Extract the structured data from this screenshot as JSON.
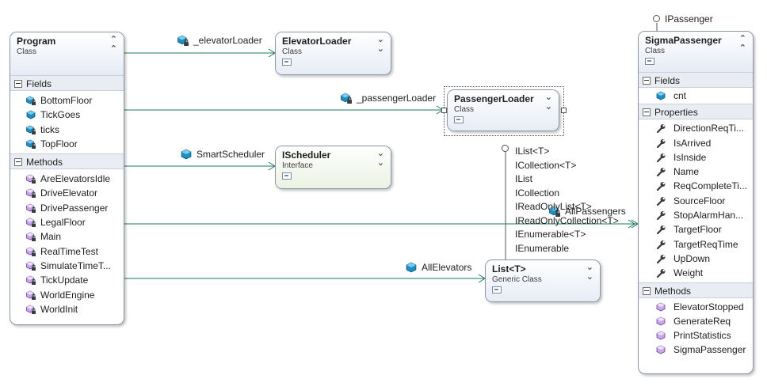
{
  "program": {
    "title": "Program",
    "kind": "Class",
    "fields_label": "Fields",
    "fields": [
      "BottomFloor",
      "TickGoes",
      "ticks",
      "TopFloor"
    ],
    "methods_label": "Methods",
    "methods": [
      "AreElevatorsIdle",
      "DriveElevator",
      "DrivePassenger",
      "LegalFloor",
      "Main",
      "RealTimeTest",
      "SimulateTimeT...",
      "TickUpdate",
      "WorldEngine",
      "WorldInit"
    ]
  },
  "elevator_loader": {
    "title": "ElevatorLoader",
    "kind": "Class"
  },
  "passenger_loader": {
    "title": "PassengerLoader",
    "kind": "Class"
  },
  "scheduler": {
    "title": "IScheduler",
    "kind": "Interface"
  },
  "list_t": {
    "title": "List<T>",
    "kind": "Generic Class"
  },
  "list_interfaces": [
    "IList<T>",
    "ICollection<T>",
    "IList",
    "ICollection",
    "IReadOnlyList<T>",
    "IReadOnlyCollection<T>",
    "IEnumerable<T>",
    "IEnumerable"
  ],
  "sigma_passenger": {
    "title": "SigmaPassenger",
    "kind": "Class",
    "interface": "IPassenger",
    "fields_label": "Fields",
    "fields": [
      "cnt"
    ],
    "properties_label": "Properties",
    "properties": [
      "DirectionReqTi...",
      "IsArrived",
      "IsInside",
      "Name",
      "ReqCompleteTi...",
      "SourceFloor",
      "StopAlarmHan...",
      "TargetFloor",
      "TargetReqTime",
      "UpDown",
      "Weight"
    ],
    "methods_label": "Methods",
    "methods": [
      "ElevatorStopped",
      "GenerateReq",
      "PrintStatistics",
      "SigmaPassenger"
    ]
  },
  "associations": {
    "elevator_loader": "_elevatorLoader",
    "passenger_loader": "_passengerLoader",
    "scheduler": "SmartScheduler",
    "passengers": "AllPassengers",
    "elevators": "AllElevators"
  },
  "colors": {
    "connector": "#1a7a5e",
    "border": "#8c96a8",
    "section_bg": "#e9edf3",
    "header_class": "#e6ebf5",
    "header_interface": "#eaf2e2"
  }
}
